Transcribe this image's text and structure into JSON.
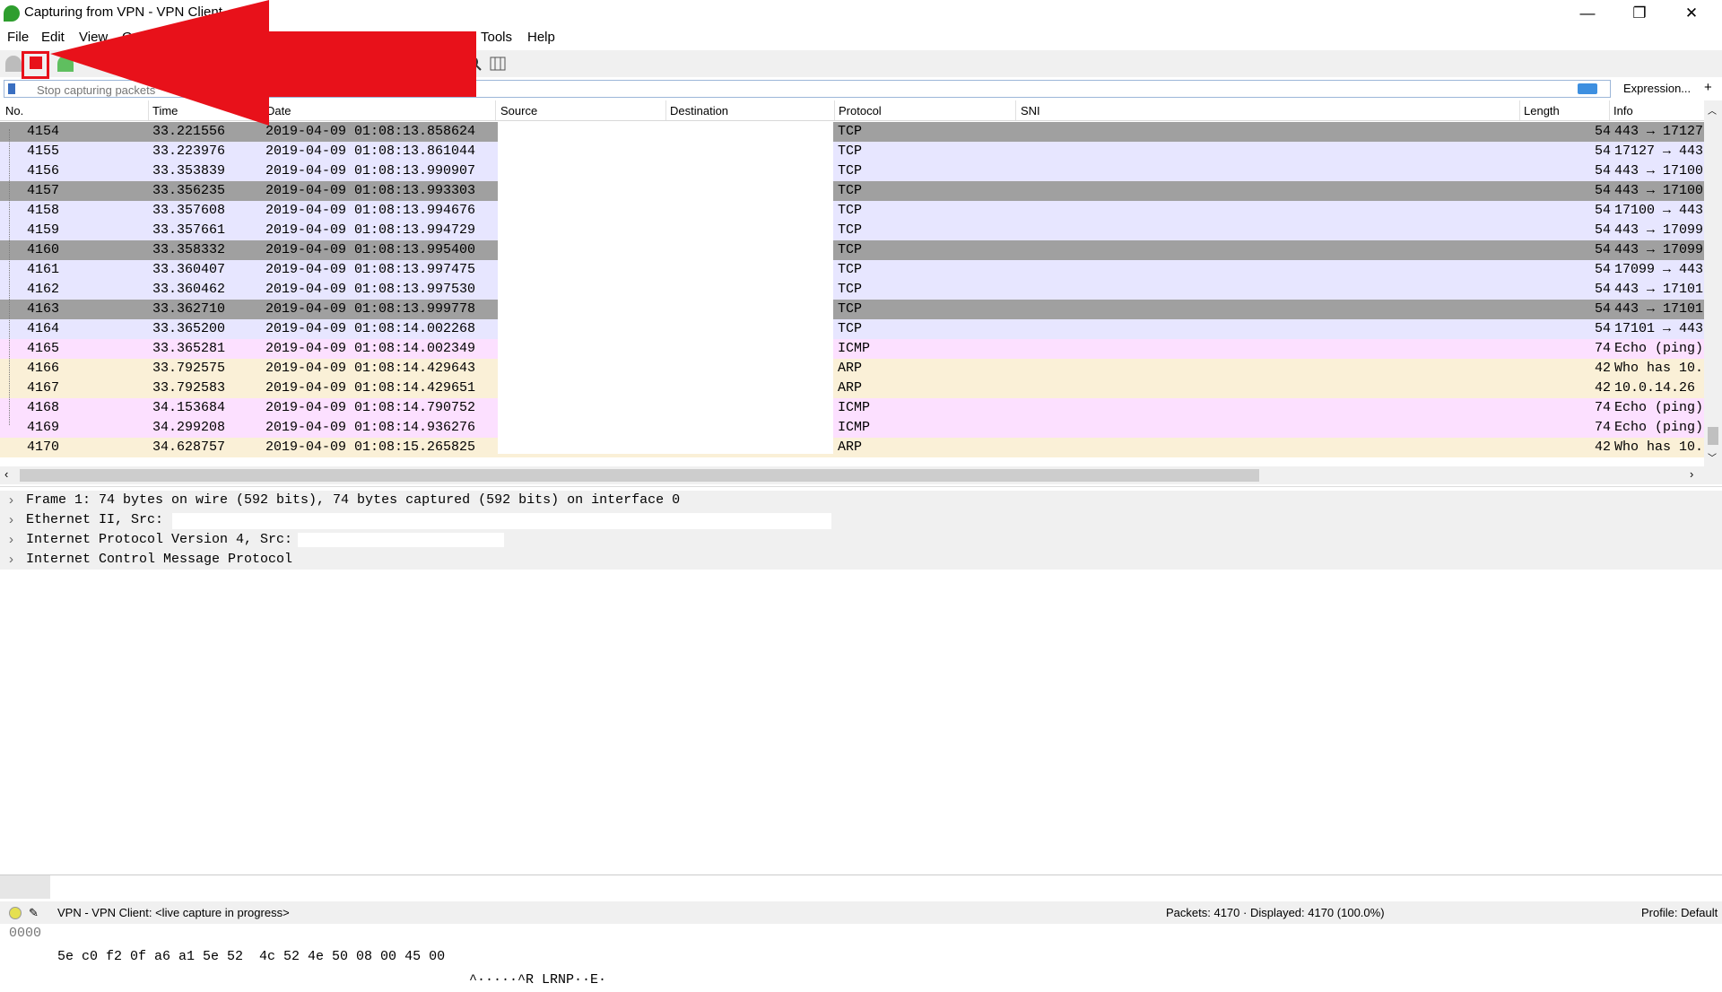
{
  "window": {
    "title": "Capturing from VPN - VPN Client",
    "minimize_glyph": "—",
    "restore_glyph": "❐",
    "close_glyph": "✕"
  },
  "menu": [
    "File",
    "Edit",
    "View",
    "Go",
    "Tools",
    "Help"
  ],
  "filter": {
    "placeholder": "Stop capturing packets",
    "expression_label": "Expression...",
    "plus_label": "+"
  },
  "columns": [
    "No.",
    "Time",
    "Date",
    "Source",
    "Destination",
    "Protocol",
    "SNI",
    "Length",
    "Info"
  ],
  "colors": {
    "tcp_light": "#e7e6ff",
    "tcp_dark": "#a0a0a0",
    "icmp": "#fce0ff",
    "arp": "#faf0d7",
    "stop_red": "#e8111a"
  },
  "packets": [
    {
      "no": "4154",
      "time": "33.221556",
      "date": "2019-04-09 01:08:13.858624",
      "protocol": "TCP",
      "length": "54",
      "info": "443 → 17127",
      "kind": "tcp_dark"
    },
    {
      "no": "4155",
      "time": "33.223976",
      "date": "2019-04-09 01:08:13.861044",
      "protocol": "TCP",
      "length": "54",
      "info": "17127 → 443",
      "kind": "tcp_light"
    },
    {
      "no": "4156",
      "time": "33.353839",
      "date": "2019-04-09 01:08:13.990907",
      "protocol": "TCP",
      "length": "54",
      "info": "443 → 17100",
      "kind": "tcp_light"
    },
    {
      "no": "4157",
      "time": "33.356235",
      "date": "2019-04-09 01:08:13.993303",
      "protocol": "TCP",
      "length": "54",
      "info": "443 → 17100",
      "kind": "tcp_dark"
    },
    {
      "no": "4158",
      "time": "33.357608",
      "date": "2019-04-09 01:08:13.994676",
      "protocol": "TCP",
      "length": "54",
      "info": "17100 → 443",
      "kind": "tcp_light"
    },
    {
      "no": "4159",
      "time": "33.357661",
      "date": "2019-04-09 01:08:13.994729",
      "protocol": "TCP",
      "length": "54",
      "info": "443 → 17099",
      "kind": "tcp_light"
    },
    {
      "no": "4160",
      "time": "33.358332",
      "date": "2019-04-09 01:08:13.995400",
      "protocol": "TCP",
      "length": "54",
      "info": "443 → 17099",
      "kind": "tcp_dark"
    },
    {
      "no": "4161",
      "time": "33.360407",
      "date": "2019-04-09 01:08:13.997475",
      "protocol": "TCP",
      "length": "54",
      "info": "17099 → 443",
      "kind": "tcp_light"
    },
    {
      "no": "4162",
      "time": "33.360462",
      "date": "2019-04-09 01:08:13.997530",
      "protocol": "TCP",
      "length": "54",
      "info": "443 → 17101",
      "kind": "tcp_light"
    },
    {
      "no": "4163",
      "time": "33.362710",
      "date": "2019-04-09 01:08:13.999778",
      "protocol": "TCP",
      "length": "54",
      "info": "443 → 17101",
      "kind": "tcp_dark"
    },
    {
      "no": "4164",
      "time": "33.365200",
      "date": "2019-04-09 01:08:14.002268",
      "protocol": "TCP",
      "length": "54",
      "info": "17101 → 443",
      "kind": "tcp_light"
    },
    {
      "no": "4165",
      "time": "33.365281",
      "date": "2019-04-09 01:08:14.002349",
      "protocol": "ICMP",
      "length": "74",
      "info": "Echo (ping)",
      "kind": "icmp"
    },
    {
      "no": "4166",
      "time": "33.792575",
      "date": "2019-04-09 01:08:14.429643",
      "protocol": "ARP",
      "length": "42",
      "info": "Who has 10.",
      "kind": "arp"
    },
    {
      "no": "4167",
      "time": "33.792583",
      "date": "2019-04-09 01:08:14.429651",
      "protocol": "ARP",
      "length": "42",
      "info": "10.0.14.26",
      "kind": "arp"
    },
    {
      "no": "4168",
      "time": "34.153684",
      "date": "2019-04-09 01:08:14.790752",
      "protocol": "ICMP",
      "length": "74",
      "info": "Echo (ping)",
      "kind": "icmp"
    },
    {
      "no": "4169",
      "time": "34.299208",
      "date": "2019-04-09 01:08:14.936276",
      "protocol": "ICMP",
      "length": "74",
      "info": "Echo (ping)",
      "kind": "icmp"
    },
    {
      "no": "4170",
      "time": "34.628757",
      "date": "2019-04-09 01:08:15.265825",
      "protocol": "ARP",
      "length": "42",
      "info": "Who has 10.",
      "kind": "arp"
    }
  ],
  "details": [
    "Frame 1: 74 bytes on wire (592 bits), 74 bytes captured (592 bits) on interface 0",
    "Ethernet II, Src:",
    "Internet Protocol Version 4, Src:",
    "Internet Control Message Protocol"
  ],
  "bytes": {
    "offset": "0000",
    "hex": "5e c0 f2 0f a6 a1 5e 52  4c 52 4e 50 08 00 45 00",
    "ascii": "^·····^R LRNP··E·"
  },
  "status": {
    "capture": "VPN - VPN Client: <live capture in progress>",
    "packets": "Packets: 4170 · Displayed: 4170 (100.0%)",
    "profile": "Profile: Default"
  }
}
